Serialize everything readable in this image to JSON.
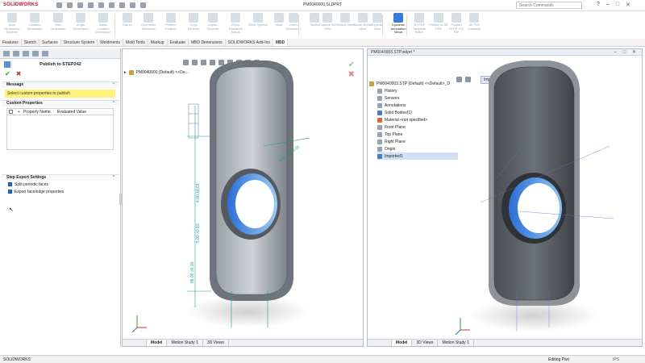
{
  "app": {
    "logo": "SOLIDWORKS",
    "document_title": "PM0040000.SLDPRT",
    "search_placeholder": "Search Commands",
    "window_controls": [
      "?",
      "–",
      "□",
      "✕"
    ]
  },
  "ribbon": {
    "buttons": [
      {
        "label": "Auto Dimension Scheme",
        "icon": "auto-dimension-icon",
        "active": false
      },
      {
        "label": "Location Dimension",
        "icon": "location-dimension-icon",
        "active": false
      },
      {
        "label": "Size Dimension",
        "icon": "size-dimension-icon",
        "active": false
      },
      {
        "label": "Angle Dimension",
        "icon": "angle-dimension-icon",
        "active": false
      },
      {
        "label": "Basic Location Dimension",
        "icon": "basic-location-icon",
        "active": false
      },
      {
        "label": "Datum",
        "icon": "datum-icon",
        "active": false
      },
      {
        "label": "Geometric Tolerance",
        "icon": "geometric-tolerance-icon",
        "active": false
      },
      {
        "label": "Pattern Feature",
        "icon": "pattern-feature-icon",
        "active": false
      },
      {
        "label": "Copy Scheme",
        "icon": "copy-scheme-icon",
        "active": false
      },
      {
        "label": "Import Scheme",
        "icon": "import-scheme-icon",
        "active": false
      },
      {
        "label": "Show Tolerance Status",
        "icon": "tolerance-status-icon",
        "active": false
      },
      {
        "label": "Weld Symbol",
        "icon": "weld-symbol-icon",
        "active": false
      },
      {
        "label": "Note",
        "icon": "note-icon",
        "active": false
      },
      {
        "label": "Insert Dimension",
        "icon": "insert-dimension-icon",
        "active": false
      },
      {
        "label": "Tables",
        "icon": "tables-icon",
        "active": false
      },
      {
        "label": "Capture 3D View",
        "icon": "capture-view-icon",
        "active": false
      },
      {
        "label": "Section View",
        "icon": "section-view-icon",
        "active": false
      },
      {
        "label": "Model Break View",
        "icon": "model-break-icon",
        "active": false
      },
      {
        "label": "Explode View",
        "icon": "explode-view-icon",
        "active": false
      },
      {
        "label": "Dynamic Annotation Views",
        "icon": "dynamic-annotation-icon",
        "active": true
      },
      {
        "label": "3D PDF Template Editor",
        "icon": "pdf-template-icon",
        "active": false
      },
      {
        "label": "Publish to 3D PDF",
        "icon": "publish-pdf-icon",
        "active": false
      },
      {
        "label": "Publish STEP 242 File",
        "icon": "publish-step-icon",
        "active": false
      },
      {
        "label": "3D PMI Compare",
        "icon": "pmi-compare-icon",
        "active": false
      }
    ]
  },
  "command_tabs": [
    "Features",
    "Sketch",
    "Surfaces",
    "Structure System",
    "Weldments",
    "Mold Tools",
    "Markup",
    "Evaluate",
    "MBD Dimensions",
    "SOLIDWORKS Add-Ins",
    "MBD"
  ],
  "command_tabs_active": 10,
  "property_manager": {
    "title": "Publish to STEP242",
    "ok_symbol": "✔",
    "cancel_symbol": "✖",
    "message_section": "Message",
    "message_text": "Select custom properties to publish",
    "custom_props_section": "Custom Properties",
    "table_headers": {
      "plus": "+",
      "name": "Property Name",
      "value": "Evaluated Value"
    },
    "export_section": "Step Export Settings",
    "options": [
      {
        "label": "Split periodic faces",
        "checked": true
      },
      {
        "label": "Export face/edge properties",
        "checked": true
      }
    ]
  },
  "left_viewport": {
    "tree_root": "PM0040000 (Default) <<De...",
    "tabs": [
      "",
      "Model",
      "Motion Study 1",
      "3D Views"
    ],
    "active_tab": 1,
    "dimensions": [
      "Ø25.00 ±0.01",
      "4.00 ±0.01",
      "5.00 ±0.10",
      "88.00 ±0.10"
    ]
  },
  "right_viewport": {
    "title": "PM0040003.STP.sldprt *",
    "tree_root": "PM0040003.STP (Default) <<Default>_D",
    "tree_items": [
      {
        "label": "History",
        "icon": "history-icon"
      },
      {
        "label": "Sensors",
        "icon": "sensors-icon"
      },
      {
        "label": "Annotations",
        "icon": "annotations-icon"
      },
      {
        "label": "Solid Bodies(1)",
        "icon": "solid-bodies-icon"
      },
      {
        "label": "Material <not specified>",
        "icon": "material-icon"
      },
      {
        "label": "Front Plane",
        "icon": "plane-icon"
      },
      {
        "label": "Top Plane",
        "icon": "plane-icon"
      },
      {
        "label": "Right Plane",
        "icon": "plane-icon"
      },
      {
        "label": "Origin",
        "icon": "origin-icon"
      },
      {
        "label": "Imported1",
        "icon": "imported-body-icon"
      }
    ],
    "breadcrumb": "Imported1",
    "tabs": [
      "",
      "Model",
      "3D Views",
      "Motion Study 1"
    ],
    "active_tab": 1
  },
  "statusbar": {
    "left": "SOLIDWORKS",
    "right": "Editing Part",
    "units": "IPS"
  }
}
